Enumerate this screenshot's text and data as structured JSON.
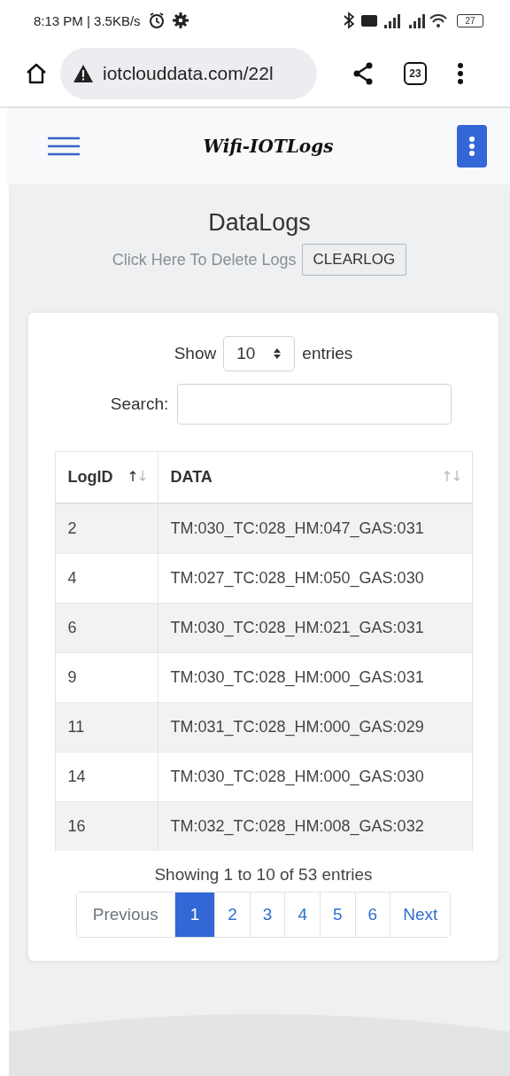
{
  "status_bar": {
    "time_speed": "8:13 PM | 3.5KB/s",
    "battery": "27"
  },
  "browser": {
    "url": "iotclouddata.com/22l",
    "tab_count": "23"
  },
  "navbar": {
    "brand": "Wifi-IOTLogs"
  },
  "header": {
    "title": "DataLogs",
    "prompt": "Click Here To Delete Logs",
    "button": "CLEARLOG"
  },
  "length_menu": {
    "before": "Show",
    "value": "10",
    "after": "entries"
  },
  "search": {
    "label": "Search:"
  },
  "table": {
    "columns": [
      {
        "label": "LogID",
        "sorted_ascending": true
      },
      {
        "label": "DATA",
        "sorted_ascending": false
      }
    ],
    "rows": [
      [
        "2",
        "TM:030_TC:028_HM:047_GAS:031"
      ],
      [
        "4",
        "TM:027_TC:028_HM:050_GAS:030"
      ],
      [
        "6",
        "TM:030_TC:028_HM:021_GAS:031"
      ],
      [
        "9",
        "TM:030_TC:028_HM:000_GAS:031"
      ],
      [
        "11",
        "TM:031_TC:028_HM:000_GAS:029"
      ],
      [
        "14",
        "TM:030_TC:028_HM:000_GAS:030"
      ],
      [
        "16",
        "TM:032_TC:028_HM:008_GAS:032"
      ]
    ]
  },
  "info": "Showing 1 to 10 of 53 entries",
  "pagination": [
    {
      "label": "Previous",
      "selected": false,
      "disabled": true
    },
    {
      "label": "1",
      "selected": true,
      "disabled": false
    },
    {
      "label": "2",
      "selected": false,
      "disabled": false
    },
    {
      "label": "3",
      "selected": false,
      "disabled": false
    },
    {
      "label": "4",
      "selected": false,
      "disabled": false
    },
    {
      "label": "5",
      "selected": false,
      "disabled": false
    },
    {
      "label": "6",
      "selected": false,
      "disabled": false
    },
    {
      "label": "Next",
      "selected": false,
      "disabled": false
    }
  ]
}
